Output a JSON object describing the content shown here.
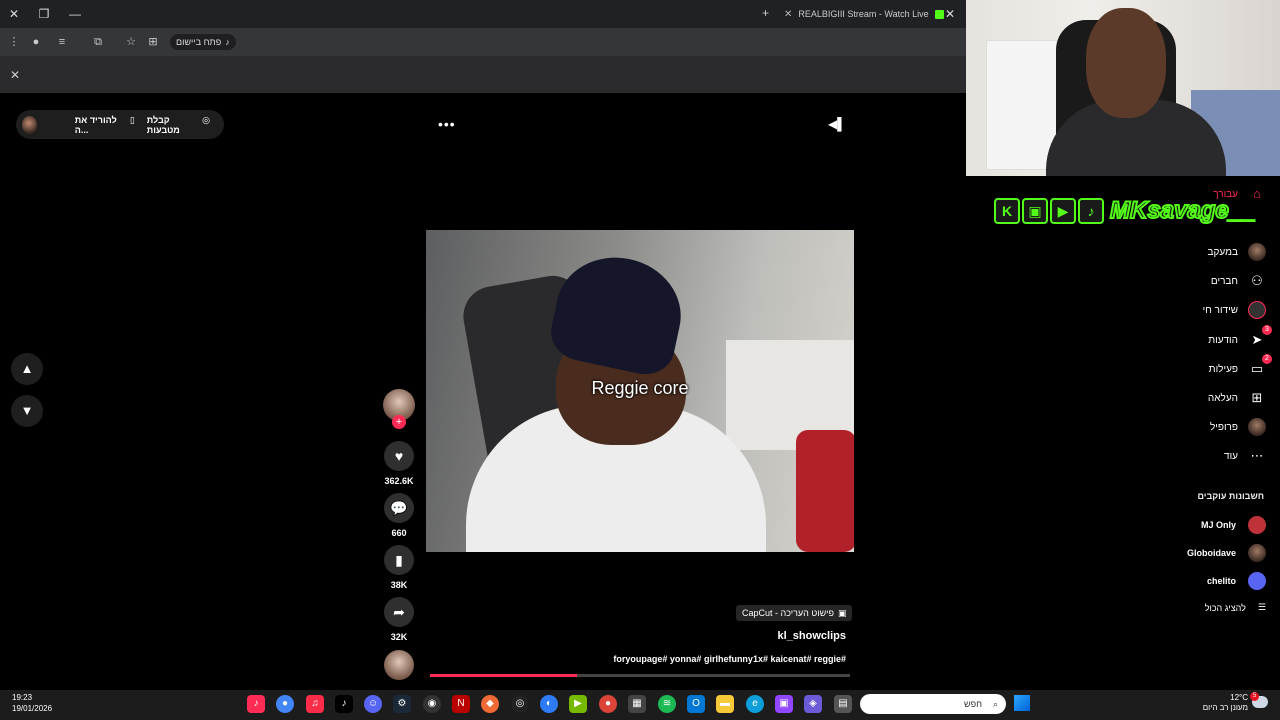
{
  "browser": {
    "tab_title": "REALBIGIII Stream - Watch Live",
    "open_in_app_label": "פתח ביישום"
  },
  "top_bar": {
    "coins_label": "קבלת מטבעות",
    "download_label": "להוריד את ה...",
    "more_label": "..."
  },
  "video": {
    "caption": "Reggie core",
    "capcut_tag": "CapCut - פישוט העריכה",
    "author": "kl_showclips",
    "hashtags": "foryoupage# yonna# girlhefunny1x# kaicenat# reggie#",
    "progress_fraction": 0.35
  },
  "actions": {
    "likes": "362.6K",
    "comments": "660",
    "saves": "38K",
    "shares": "32K"
  },
  "overlay": {
    "brand_name": "MKsavage__"
  },
  "sidebar": {
    "items": [
      {
        "label": "עבורך",
        "icon": "home-icon"
      },
      {
        "label": "במעקב",
        "icon": "avatar"
      },
      {
        "label": "חברים",
        "icon": "friends-icon"
      },
      {
        "label": "שידור חי",
        "icon": "live-icon"
      },
      {
        "label": "הודעות",
        "icon": "send-icon",
        "badge": "3"
      },
      {
        "label": "פעילות",
        "icon": "activity-icon",
        "badge": "2"
      },
      {
        "label": "העלאה",
        "icon": "upload-icon"
      },
      {
        "label": "פרופיל",
        "icon": "profile-avatar"
      },
      {
        "label": "עוד",
        "icon": "more-icon"
      }
    ],
    "following_title": "חשבונות עוקבים",
    "following": [
      {
        "name": "MJ Only"
      },
      {
        "name": "Globoidave"
      },
      {
        "name": "chelito"
      }
    ],
    "show_all": "להציג הכול"
  },
  "taskbar": {
    "time": "19:23",
    "date": "19/01/2026",
    "search_placeholder": "חפש",
    "temperature": "12°C",
    "weather_desc": "מעונן רב היום",
    "weather_badge": "5"
  }
}
